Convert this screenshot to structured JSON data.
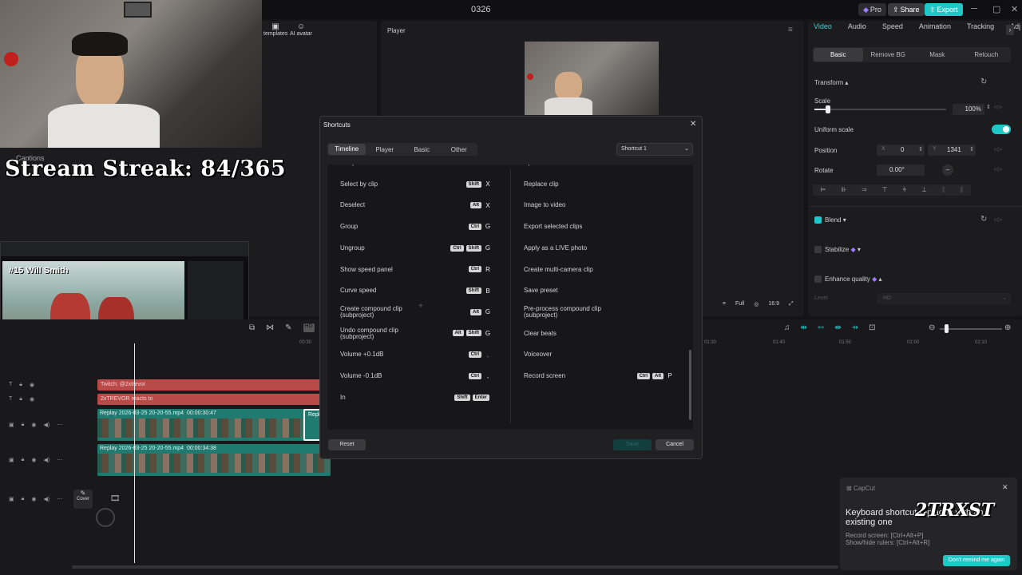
{
  "app": {
    "project_name": "0326",
    "pro_label": "Pro",
    "share_label": "Share",
    "export_label": "Export",
    "window_controls": [
      "─",
      "▢",
      "✕"
    ]
  },
  "left_panel": {
    "templates_label": "templates",
    "ai_avatar_label": "AI avatar",
    "captions_label": "Captions"
  },
  "overlay": {
    "stream_streak": "Stream Streak: 84/365",
    "webcam_alt": "",
    "video_label": "#15 Will Smith"
  },
  "player": {
    "title": "Player",
    "tools": [
      "⌗",
      "Full",
      "◎",
      "16:9",
      "⤢"
    ]
  },
  "right_panel": {
    "tabs": [
      "Video",
      "Audio",
      "Speed",
      "Animation",
      "Tracking",
      "Adj"
    ],
    "subtabs": [
      "Basic",
      "Remove BG",
      "Mask",
      "Retouch"
    ],
    "transform_label": "Transform",
    "scale_label": "Scale",
    "scale_value": "100%",
    "scale_fraction": 0.1,
    "uniform_scale_label": "Uniform scale",
    "position_label": "Position",
    "pos_x_label": "X",
    "pos_x": "0",
    "pos_y_label": "Y",
    "pos_y": "1341",
    "rotate_label": "Rotate",
    "rotate_value": "0.00°",
    "blend_label": "Blend",
    "stabilize_label": "Stabilize",
    "enhance_label": "Enhance quality",
    "level_label": "Level",
    "level_value": "HD"
  },
  "dialog": {
    "title": "Shortcuts",
    "tabs": [
      "Timeline",
      "Player",
      "Basic",
      "Other"
    ],
    "preset": "Shortcut 1",
    "reset_label": "Reset",
    "save_label": "Save",
    "cancel_label": "Cancel",
    "left": [
      {
        "label": "Out point",
        "mods": [],
        "key": "O"
      },
      {
        "label": "Select by clip",
        "mods": [
          "Shift"
        ],
        "key": "X"
      },
      {
        "label": "Deselect",
        "mods": [
          "Alt"
        ],
        "key": "X"
      },
      {
        "label": "Group",
        "mods": [
          "Ctrl"
        ],
        "key": "G"
      },
      {
        "label": "Ungroup",
        "mods": [
          "Ctrl",
          "Shift"
        ],
        "key": "G"
      },
      {
        "label": "Show speed panel",
        "mods": [
          "Ctrl"
        ],
        "key": "R"
      },
      {
        "label": "Curve speed",
        "mods": [
          "Shift"
        ],
        "key": "B"
      },
      {
        "label": "Create compound clip\n(subproject)",
        "mods": [
          "Alt"
        ],
        "key": "G"
      },
      {
        "label": "Undo compound clip\n(subproject)",
        "mods": [
          "Alt",
          "Shift"
        ],
        "key": "G"
      },
      {
        "label": "Volume +0.1dB",
        "mods": [
          "Ctrl"
        ],
        "key": "."
      },
      {
        "label": "Volume -0.1dB",
        "mods": [
          "Ctrl"
        ],
        "key": ","
      },
      {
        "label": "In",
        "mods": [
          "Shift",
          "Enter"
        ],
        "key": ""
      }
    ],
    "right": [
      {
        "label": "Split scenes",
        "mods": [],
        "key": ""
      },
      {
        "label": "Replace clip",
        "mods": [],
        "key": ""
      },
      {
        "label": "Image to video",
        "mods": [],
        "key": ""
      },
      {
        "label": "Export selected clips",
        "mods": [],
        "key": ""
      },
      {
        "label": "Apply as a LIVE photo",
        "mods": [],
        "key": ""
      },
      {
        "label": "Create multi-camera clip",
        "mods": [],
        "key": ""
      },
      {
        "label": "Save preset",
        "mods": [],
        "key": ""
      },
      {
        "label": "Pre-process compound clip\n(subproject)",
        "mods": [],
        "key": ""
      },
      {
        "label": "Clear beats",
        "mods": [],
        "key": ""
      },
      {
        "label": "Voiceover",
        "mods": [],
        "key": ""
      },
      {
        "label": "Record screen",
        "mods": [
          "Ctrl",
          "Alt"
        ],
        "key": "P"
      }
    ]
  },
  "timeline": {
    "ruler": [
      "00:30",
      "01:30",
      "01:40",
      "01:50",
      "02:00",
      "02:10"
    ],
    "text_clip_1": "Twitch: @2xtrevor",
    "text_clip_2": "2xTREVOR reacts to",
    "video_clip_1_name": "Replay 2026-03-25 20-20-55.mp4",
    "video_clip_1_dur": "00:00:30:47",
    "video_clip_1b": "Replay",
    "video_clip_2_name": "Replay 2026-03-25 20-20-55.mp4",
    "video_clip_2_dur": "00:00:34:38",
    "cover_label": "Cover"
  },
  "toast": {
    "app": "CapCut",
    "title": "Keyboard shortcut replaced with an existing one",
    "line1": "Record screen: [Ctrl+Alt+P]",
    "line2": "Show/hide rulers: [Ctrl+Alt+R]",
    "button": "Don't remind me again",
    "watermark": "2TRXST"
  },
  "colors": {
    "accent": "#1fc7c7",
    "text_clip": "#b94a48",
    "video_clip": "#1f7a70"
  }
}
